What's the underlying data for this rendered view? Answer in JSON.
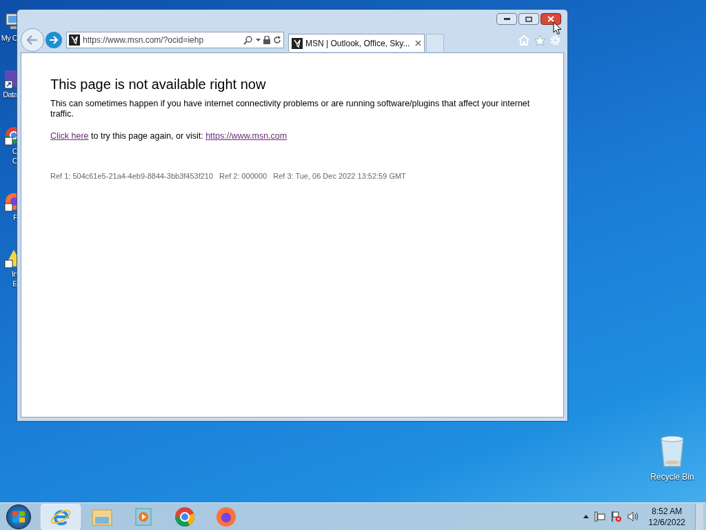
{
  "desktop_icons": [
    {
      "kind": "computer",
      "label": [
        "My C"
      ]
    },
    {
      "kind": "shortcut",
      "label": [
        "Data"
      ]
    },
    {
      "kind": "chrome",
      "label": [
        "C",
        "C"
      ]
    },
    {
      "kind": "firefox",
      "label": [
        "F"
      ]
    },
    {
      "kind": "ie",
      "label": [
        "In",
        "E"
      ]
    }
  ],
  "recycle_bin": {
    "label": "Recycle Bin"
  },
  "browser": {
    "address": "https://www.msn.com/?ocid=iehp",
    "tabs": [
      {
        "title": "MSN | Outlook, Office, Sky...",
        "selected": true
      }
    ],
    "page": {
      "heading": "This page is not available right now",
      "body": "This can sometimes happen if you have internet connectivity problems or are running software/plugins that affect your internet traffic.",
      "link1": "Click here",
      "link_text": "to try this page again, or visit:",
      "link2": "https://www.msn.com",
      "refs": [
        "Ref 1: 504c61e5-21a4-4eb9-8844-3bb3f453f210",
        "Ref 2: 000000",
        "Ref 3: Tue, 06 Dec 2022 13:52:59 GMT"
      ]
    }
  },
  "taskbar": {
    "apps": [
      {
        "kind": "ie",
        "selected": true
      },
      {
        "kind": "explorer",
        "selected": false
      },
      {
        "kind": "media",
        "selected": false
      },
      {
        "kind": "chrome",
        "selected": false
      },
      {
        "kind": "firefox",
        "selected": false
      }
    ],
    "time": "8:52 AM",
    "date": "12/6/2022"
  }
}
